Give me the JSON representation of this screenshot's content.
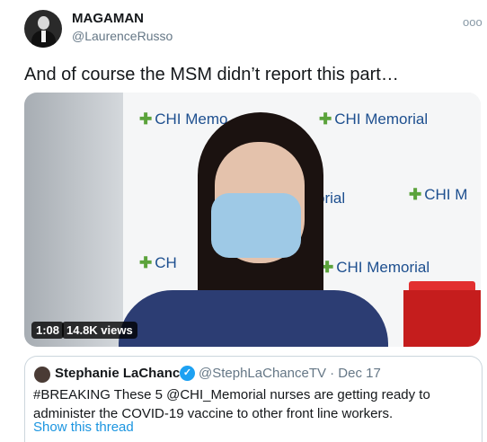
{
  "author": {
    "name": "MAGAMAN",
    "handle": "@LaurenceRusso",
    "avatar": "avatar-icon"
  },
  "more_menu": "ooo",
  "tweet_text": "And of course the MSM didn’t report this part…",
  "media": {
    "background_logo_texts": [
      "CHI Memo",
      "CHI Memorial",
      "orial",
      "CHI M",
      "CH",
      "CHI Memorial"
    ],
    "duration": "1:08",
    "views": "14.8K views"
  },
  "quoted_tweet": {
    "name": "Stephanie LaChance",
    "verified_icon": "verified-badge-icon",
    "handle_date": "@StephLaChanceTV · Dec 17",
    "text": "#BREAKING These 5 @CHI_Memorial nurses are getting ready to administer the COVID-19 vaccine to other front line workers.",
    "show_thread": "Show this thread"
  },
  "colors": {
    "link": "#1b95e0",
    "verified": "#1da1f2",
    "secondary_text": "#657786"
  }
}
